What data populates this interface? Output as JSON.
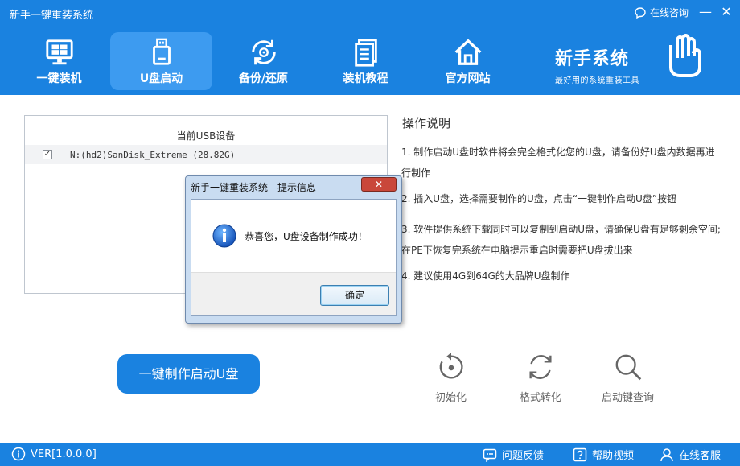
{
  "window": {
    "title": "新手一键重装系统",
    "consult_label": "在线咨询",
    "minimize_glyph": "—",
    "close_glyph": "✕"
  },
  "nav": {
    "items": [
      {
        "label": "一键装机",
        "icon": "monitor-icon"
      },
      {
        "label": "U盘启动",
        "icon": "usb-icon",
        "active": true
      },
      {
        "label": "备份/还原",
        "icon": "backup-icon"
      },
      {
        "label": "装机教程",
        "icon": "document-icon"
      },
      {
        "label": "官方网站",
        "icon": "home-icon"
      }
    ]
  },
  "brand": {
    "name": "新手系统",
    "subtitle": "最好用的系统重装工具"
  },
  "usb": {
    "header": "当前USB设备",
    "devices": [
      {
        "label": "N:(hd2)SanDisk_Extreme (28.82G)",
        "checked": true
      }
    ],
    "check_glyph": "✓"
  },
  "instructions": {
    "title": "操作说明",
    "items": [
      "1.  制作启动U盘时软件将会完全格式化您的U盘，请备份好U盘内数据再进行制作",
      "2.  插入U盘，选择需要制作的U盘，点击“一键制作启动U盘”按钮",
      "3.  软件提供系统下载同时可以复制到启动U盘，请确保U盘有足够剩余空间;在PE下恢复完系统在电脑提示重启时需要把U盘拔出来",
      "4.  建议使用4G到64G的大品牌U盘制作"
    ]
  },
  "actions": {
    "make_label": "一键制作启动U盘",
    "tools": [
      {
        "label": "初始化",
        "icon": "reset-icon"
      },
      {
        "label": "格式转化",
        "icon": "convert-icon"
      },
      {
        "label": "启动键查询",
        "icon": "search-icon"
      }
    ]
  },
  "footer": {
    "version": "VER[1.0.0.0]",
    "feedback": "问题反馈",
    "help_video": "帮助视频",
    "online_service": "在线客服"
  },
  "dialog": {
    "title": "新手一键重装系统 - 提示信息",
    "close_glyph": "✕",
    "message": "恭喜您，U盘设备制作成功！",
    "ok_label": "确定"
  },
  "colors": {
    "primary": "#1a82e0",
    "nav_active": "#3d9bf0",
    "dialog_frame": "#c9dcf1",
    "dialog_close": "#c9473a"
  }
}
